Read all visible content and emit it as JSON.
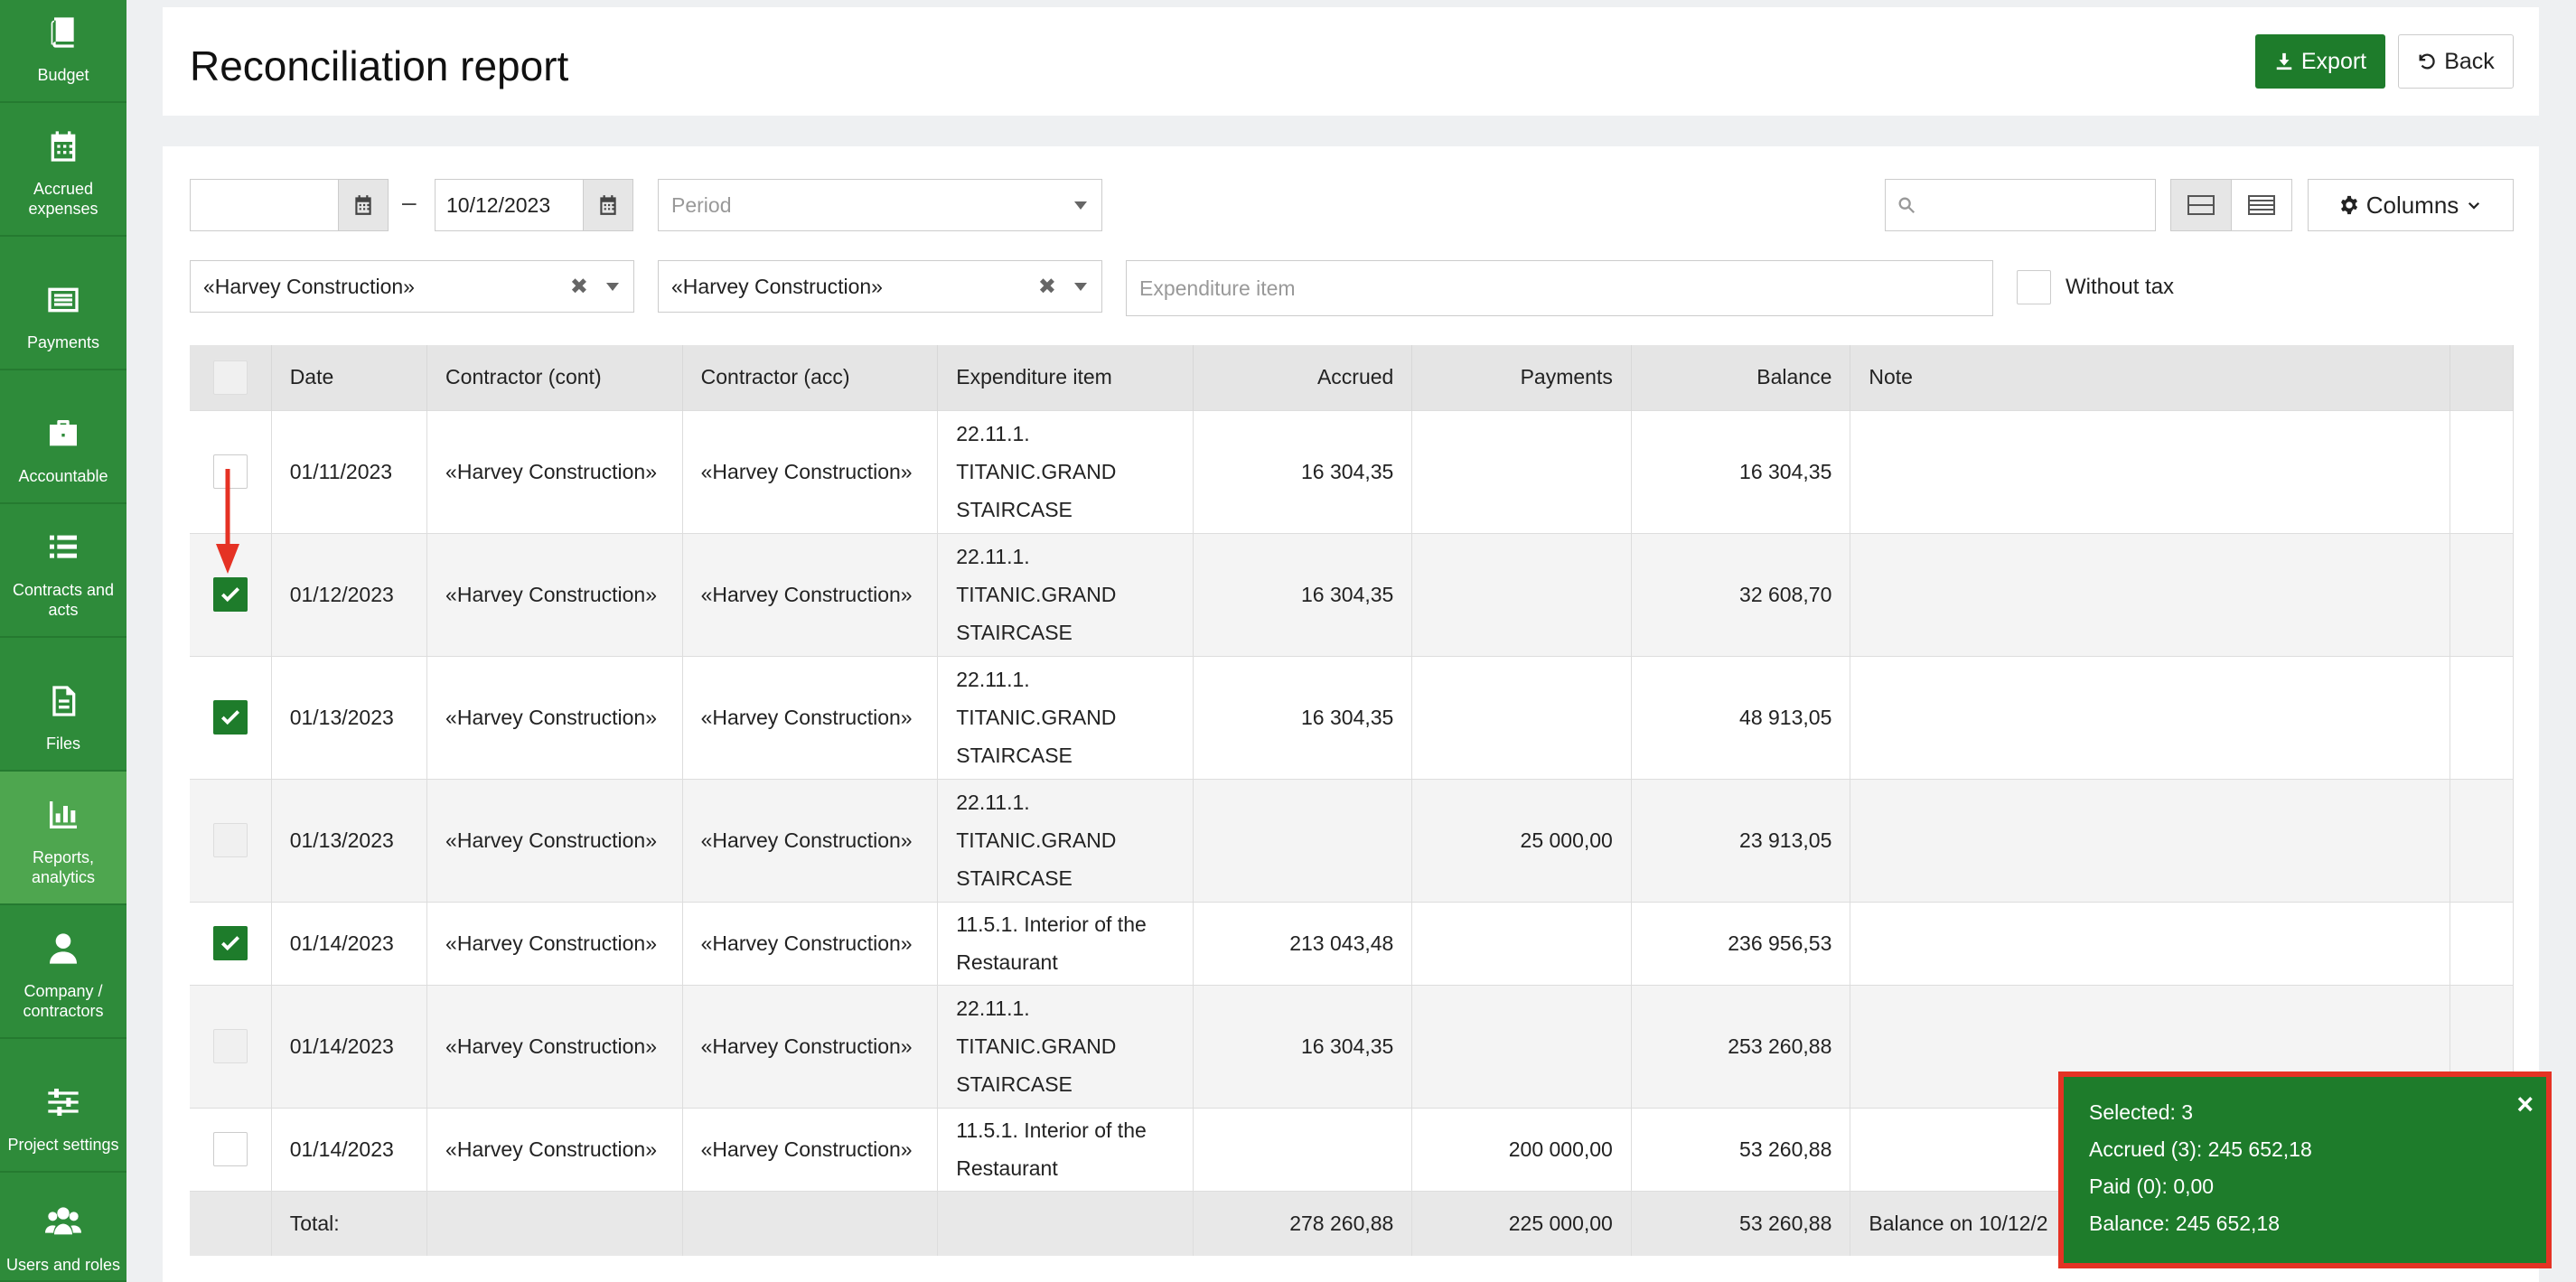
{
  "sidebar": {
    "items": [
      {
        "label": "Budget",
        "icon": "book-icon"
      },
      {
        "label": "Accrued expenses",
        "icon": "calendar-icon"
      },
      {
        "label": "Payments",
        "icon": "list-card-icon"
      },
      {
        "label": "Accountable",
        "icon": "briefcase-icon"
      },
      {
        "label": "Contracts and acts",
        "icon": "list-icon"
      },
      {
        "label": "Files",
        "icon": "file-icon"
      },
      {
        "label": "Reports, analytics",
        "icon": "bar-chart-icon"
      },
      {
        "label": "Company / contractors",
        "icon": "user-icon"
      },
      {
        "label": "Project settings",
        "icon": "sliders-icon"
      },
      {
        "label": "Users and roles",
        "icon": "users-icon"
      }
    ]
  },
  "header": {
    "title": "Reconciliation report",
    "export_label": "Export",
    "back_label": "Back"
  },
  "filters": {
    "date_from": "",
    "date_to": "10/12/2023",
    "period_placeholder": "Period",
    "contractor_cont": "«Harvey Construction»",
    "contractor_acc": "«Harvey Construction»",
    "expenditure_placeholder": "Expenditure item",
    "without_tax_label": "Without tax",
    "search_placeholder": "",
    "columns_label": "Columns"
  },
  "table": {
    "headers": [
      "Date",
      "Contractor (cont)",
      "Contractor (acc)",
      "Expenditure item",
      "Accrued",
      "Payments",
      "Balance",
      "Note"
    ],
    "rows": [
      {
        "checked": false,
        "date": "01/11/2023",
        "cont": "«Harvey Construction»",
        "acc": "«Harvey Construction»",
        "item": "22.11.1. TITANIC.GRAND STAIRCASE",
        "accrued": "16 304,35",
        "payments": "",
        "balance": "16 304,35",
        "note": ""
      },
      {
        "checked": true,
        "date": "01/12/2023",
        "cont": "«Harvey Construction»",
        "acc": "«Harvey Construction»",
        "item": "22.11.1. TITANIC.GRAND STAIRCASE",
        "accrued": "16 304,35",
        "payments": "",
        "balance": "32 608,70",
        "note": ""
      },
      {
        "checked": true,
        "date": "01/13/2023",
        "cont": "«Harvey Construction»",
        "acc": "«Harvey Construction»",
        "item": "22.11.1. TITANIC.GRAND STAIRCASE",
        "accrued": "16 304,35",
        "payments": "",
        "balance": "48 913,05",
        "note": ""
      },
      {
        "checked": false,
        "date": "01/13/2023",
        "cont": "«Harvey Construction»",
        "acc": "«Harvey Construction»",
        "item": "22.11.1. TITANIC.GRAND STAIRCASE",
        "accrued": "",
        "payments": "25 000,00",
        "balance": "23 913,05",
        "note": ""
      },
      {
        "checked": true,
        "date": "01/14/2023",
        "cont": "«Harvey Construction»",
        "acc": "«Harvey Construction»",
        "item": "11.5.1. Interior of the Restaurant",
        "accrued": "213 043,48",
        "payments": "",
        "balance": "236 956,53",
        "note": ""
      },
      {
        "checked": false,
        "date": "01/14/2023",
        "cont": "«Harvey Construction»",
        "acc": "«Harvey Construction»",
        "item": "22.11.1. TITANIC.GRAND STAIRCASE",
        "accrued": "16 304,35",
        "payments": "",
        "balance": "253 260,88",
        "note": ""
      },
      {
        "checked": false,
        "date": "01/14/2023",
        "cont": "«Harvey Construction»",
        "acc": "«Harvey Construction»",
        "item": "11.5.1. Interior of the Restaurant",
        "accrued": "",
        "payments": "200 000,00",
        "balance": "53 260,88",
        "note": ""
      }
    ],
    "total": {
      "label": "Total:",
      "accrued": "278 260,88",
      "payments": "225 000,00",
      "balance": "53 260,88",
      "note": "Balance on 10/12/2"
    }
  },
  "selection": {
    "selected": "Selected: 3",
    "accrued": "Accrued (3): 245 652,18",
    "paid": "Paid (0): 0,00",
    "balance": "Balance: 245 652,18",
    "close": "×"
  },
  "colors": {
    "sidebar": "#2e8b3a",
    "sidebar_active": "#4ea64f",
    "primary_button": "#1e7c2b",
    "popup_border": "#e53224"
  }
}
